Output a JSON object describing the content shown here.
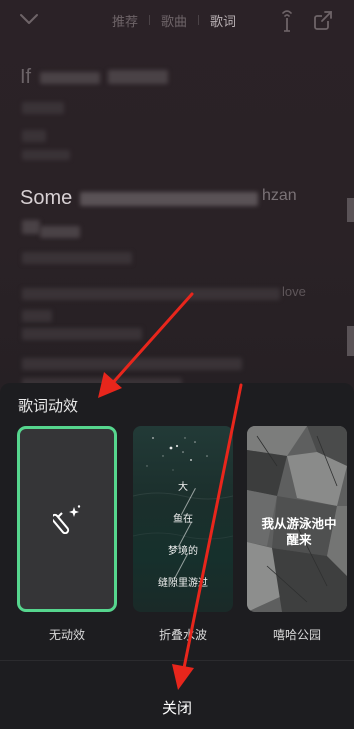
{
  "header": {
    "tabs": [
      {
        "label": "推荐",
        "active": false
      },
      {
        "label": "歌曲",
        "active": false
      },
      {
        "label": "歌词",
        "active": true
      }
    ]
  },
  "lyrics": {
    "line1_visible": "If",
    "line2_visible": "Some",
    "line2_tail": "hzan",
    "line3_tail": "love"
  },
  "sheet": {
    "title": "歌词动效",
    "effects": [
      {
        "label": "无动效",
        "selected": true,
        "icon": "magic-wand-icon"
      },
      {
        "label": "折叠水波",
        "selected": false,
        "preview_lines": [
          "大",
          "鱼在",
          "梦境的",
          "缝隙里游过"
        ]
      },
      {
        "label": "嘻哈公园",
        "selected": false,
        "preview_text": "我从游泳池中醒来"
      }
    ],
    "close_label": "关闭"
  },
  "colors": {
    "selected_border": "#56d68e",
    "annotation_arrow": "#e8261c"
  }
}
